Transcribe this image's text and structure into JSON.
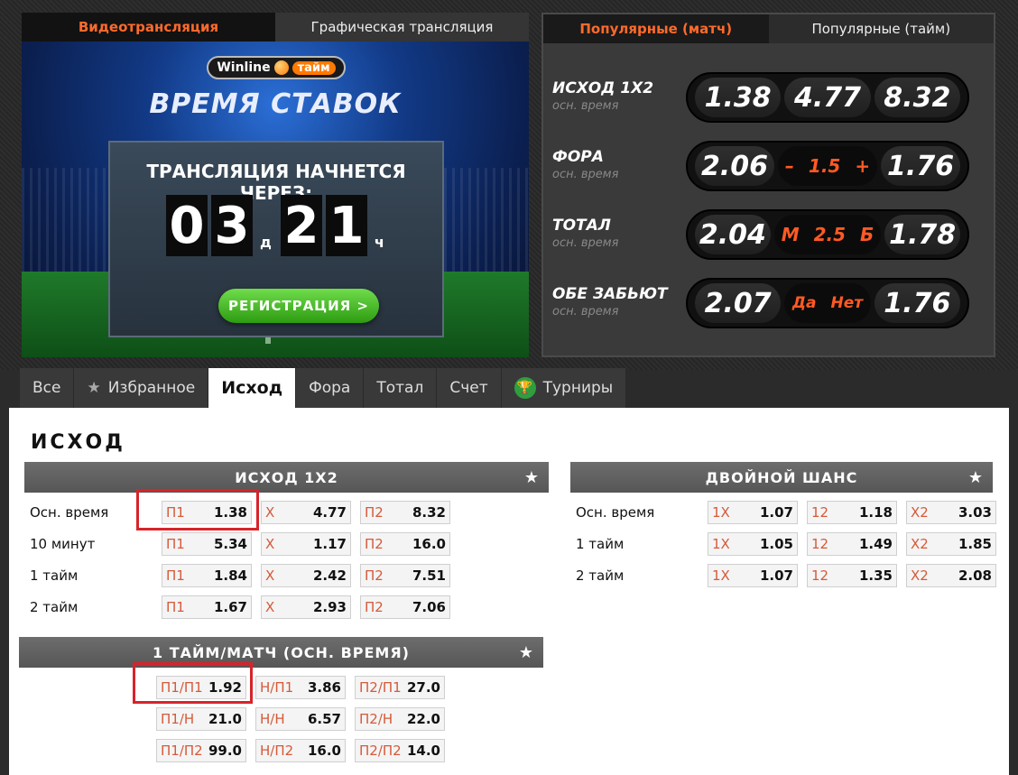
{
  "video": {
    "tabs": [
      "Видеотрансляция",
      "Графическая трансляция"
    ],
    "logo_brand": "Winline",
    "logo_time": "тайм",
    "slogan": "ВРЕМЯ СТАВОК",
    "board_title": "ТРАНСЛЯЦИЯ НАЧНЕТСЯ ЧЕРЕЗ:",
    "days": [
      "0",
      "3"
    ],
    "days_unit": "д",
    "hours": [
      "2",
      "1"
    ],
    "hours_unit": "ч",
    "register_label": "РЕГИСТРАЦИЯ >"
  },
  "popular": {
    "tabs": [
      "Популярные (матч)",
      "Популярные (тайм)"
    ],
    "rows": [
      {
        "name": "ИСХОД 1Х2",
        "sub": "осн. время",
        "left": "1.38",
        "mid": "4.77",
        "right": "8.32",
        "mid_is_label": false
      },
      {
        "name": "ФОРА",
        "sub": "осн. время",
        "left": "2.06",
        "mid_a": "–",
        "mid": "1.5",
        "mid_b": "+",
        "right": "1.76",
        "mid_is_label": true
      },
      {
        "name": "ТОТАЛ",
        "sub": "осн. время",
        "left": "2.04",
        "mid_a": "М",
        "mid": "2.5",
        "mid_b": "Б",
        "right": "1.78",
        "mid_is_label": true
      },
      {
        "name": "ОБЕ ЗАБЬЮТ",
        "sub": "осн. время",
        "left": "2.07",
        "mid_a": "Да",
        "mid": "",
        "mid_b": "Нет",
        "right": "1.76",
        "mid_is_label": true
      }
    ]
  },
  "market_tabs": [
    "Все",
    "Избранное",
    "Исход",
    "Фора",
    "Тотал",
    "Счет",
    "Турниры"
  ],
  "section_title": "ИСХОД",
  "outcome_1x2": {
    "title": "ИСХОД 1Х2",
    "rows": [
      {
        "label": "Осн. время",
        "cells": [
          {
            "k": "П1",
            "v": "1.38"
          },
          {
            "k": "Х",
            "v": "4.77"
          },
          {
            "k": "П2",
            "v": "8.32"
          }
        ]
      },
      {
        "label": "10 минут",
        "cells": [
          {
            "k": "П1",
            "v": "5.34"
          },
          {
            "k": "Х",
            "v": "1.17"
          },
          {
            "k": "П2",
            "v": "16.0"
          }
        ]
      },
      {
        "label": "1 тайм",
        "cells": [
          {
            "k": "П1",
            "v": "1.84"
          },
          {
            "k": "Х",
            "v": "2.42"
          },
          {
            "k": "П2",
            "v": "7.51"
          }
        ]
      },
      {
        "label": "2 тайм",
        "cells": [
          {
            "k": "П1",
            "v": "1.67"
          },
          {
            "k": "Х",
            "v": "2.93"
          },
          {
            "k": "П2",
            "v": "7.06"
          }
        ]
      }
    ]
  },
  "double_chance": {
    "title": "ДВОЙНОЙ ШАНС",
    "rows": [
      {
        "label": "Осн. время",
        "cells": [
          {
            "k": "1Х",
            "v": "1.07"
          },
          {
            "k": "12",
            "v": "1.18"
          },
          {
            "k": "Х2",
            "v": "3.03"
          }
        ]
      },
      {
        "label": "1 тайм",
        "cells": [
          {
            "k": "1Х",
            "v": "1.05"
          },
          {
            "k": "12",
            "v": "1.49"
          },
          {
            "k": "Х2",
            "v": "1.85"
          }
        ]
      },
      {
        "label": "2 тайм",
        "cells": [
          {
            "k": "1Х",
            "v": "1.07"
          },
          {
            "k": "12",
            "v": "1.35"
          },
          {
            "k": "Х2",
            "v": "2.08"
          }
        ]
      }
    ]
  },
  "half_full": {
    "title": "1 ТАЙМ/МАТЧ (ОСН. ВРЕМЯ)",
    "rows": [
      {
        "cells": [
          {
            "k": "П1/П1",
            "v": "1.92"
          },
          {
            "k": "Н/П1",
            "v": "3.86"
          },
          {
            "k": "П2/П1",
            "v": "27.0"
          }
        ]
      },
      {
        "cells": [
          {
            "k": "П1/Н",
            "v": "21.0"
          },
          {
            "k": "Н/Н",
            "v": "6.57"
          },
          {
            "k": "П2/Н",
            "v": "22.0"
          }
        ]
      },
      {
        "cells": [
          {
            "k": "П1/П2",
            "v": "99.0"
          },
          {
            "k": "Н/П2",
            "v": "16.0"
          },
          {
            "k": "П2/П2",
            "v": "14.0"
          }
        ]
      }
    ]
  }
}
